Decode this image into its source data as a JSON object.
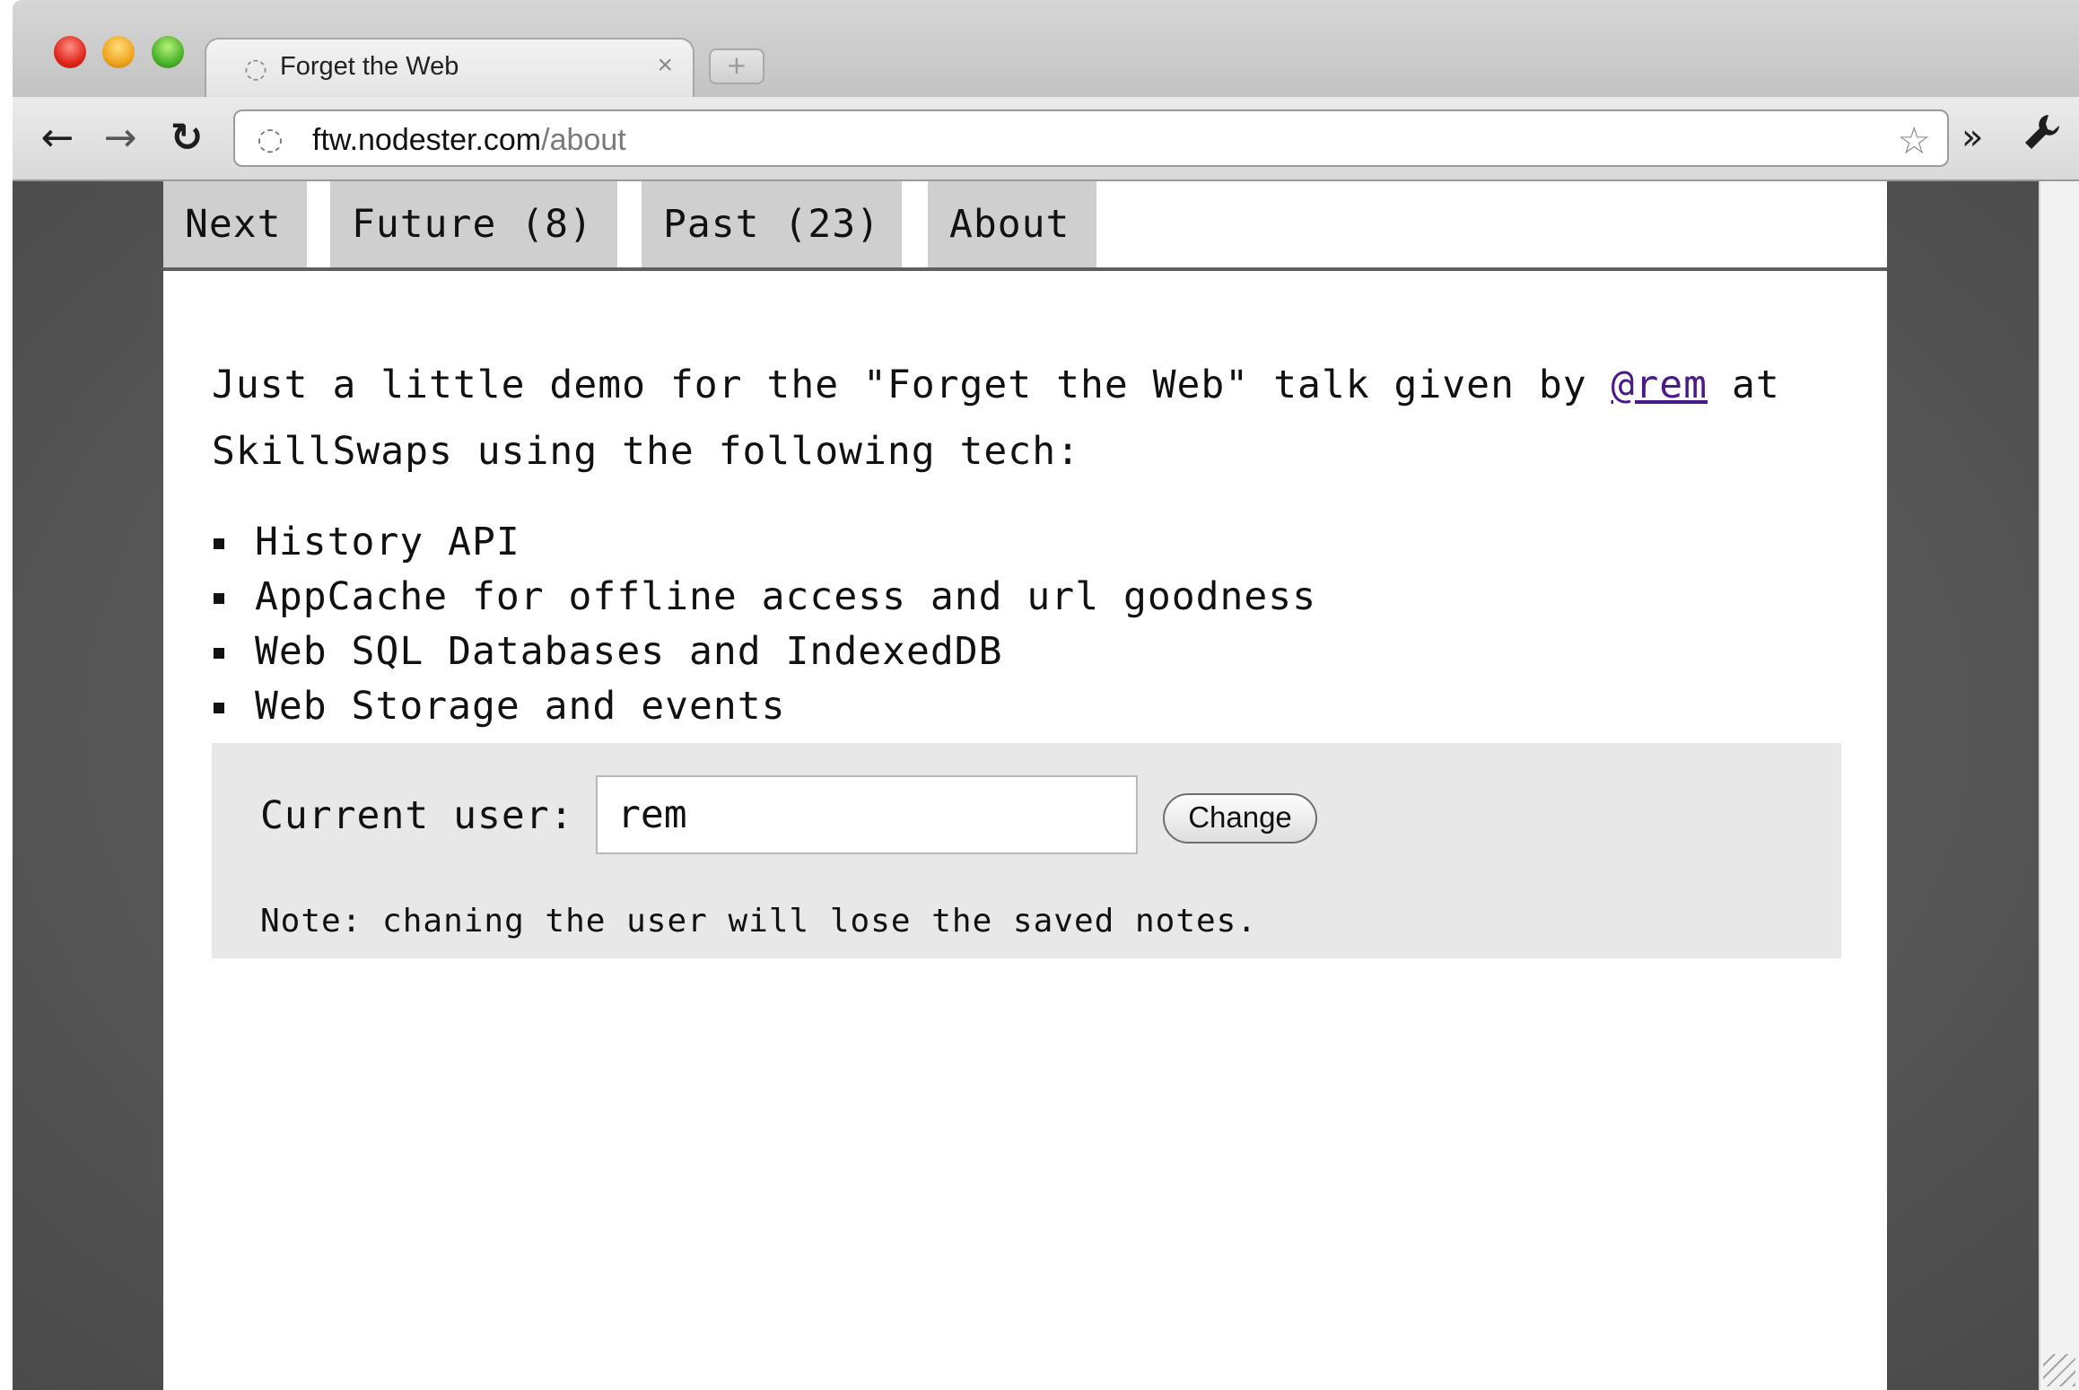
{
  "browser": {
    "tab_title": "Forget the Web",
    "tab_close": "×",
    "new_tab": "+",
    "url_host": "ftw.nodester.com",
    "url_path": "/about",
    "back_glyph": "←",
    "forward_glyph": "→",
    "reload_glyph": "↻",
    "star_glyph": "☆",
    "overflow_glyph": "»",
    "wrench_glyph": "🔧",
    "globe_glyph": "◌"
  },
  "nav": {
    "tabs": [
      {
        "label": "Next"
      },
      {
        "label": "Future (8)"
      },
      {
        "label": "Past (23)"
      },
      {
        "label": "About"
      }
    ]
  },
  "content": {
    "intro_before": "Just a little demo for the \"Forget the Web\" talk given by ",
    "intro_link": "@rem",
    "intro_after": " at SkillSwaps using the following tech:",
    "tech": [
      "History API",
      "AppCache for offline access and url goodness",
      "Web SQL Databases and IndexedDB",
      "Web Storage and events"
    ],
    "user_label": "Current user:",
    "user_value": "rem",
    "change_label": "Change",
    "note": "Note: chaning the user will lose the saved notes."
  }
}
